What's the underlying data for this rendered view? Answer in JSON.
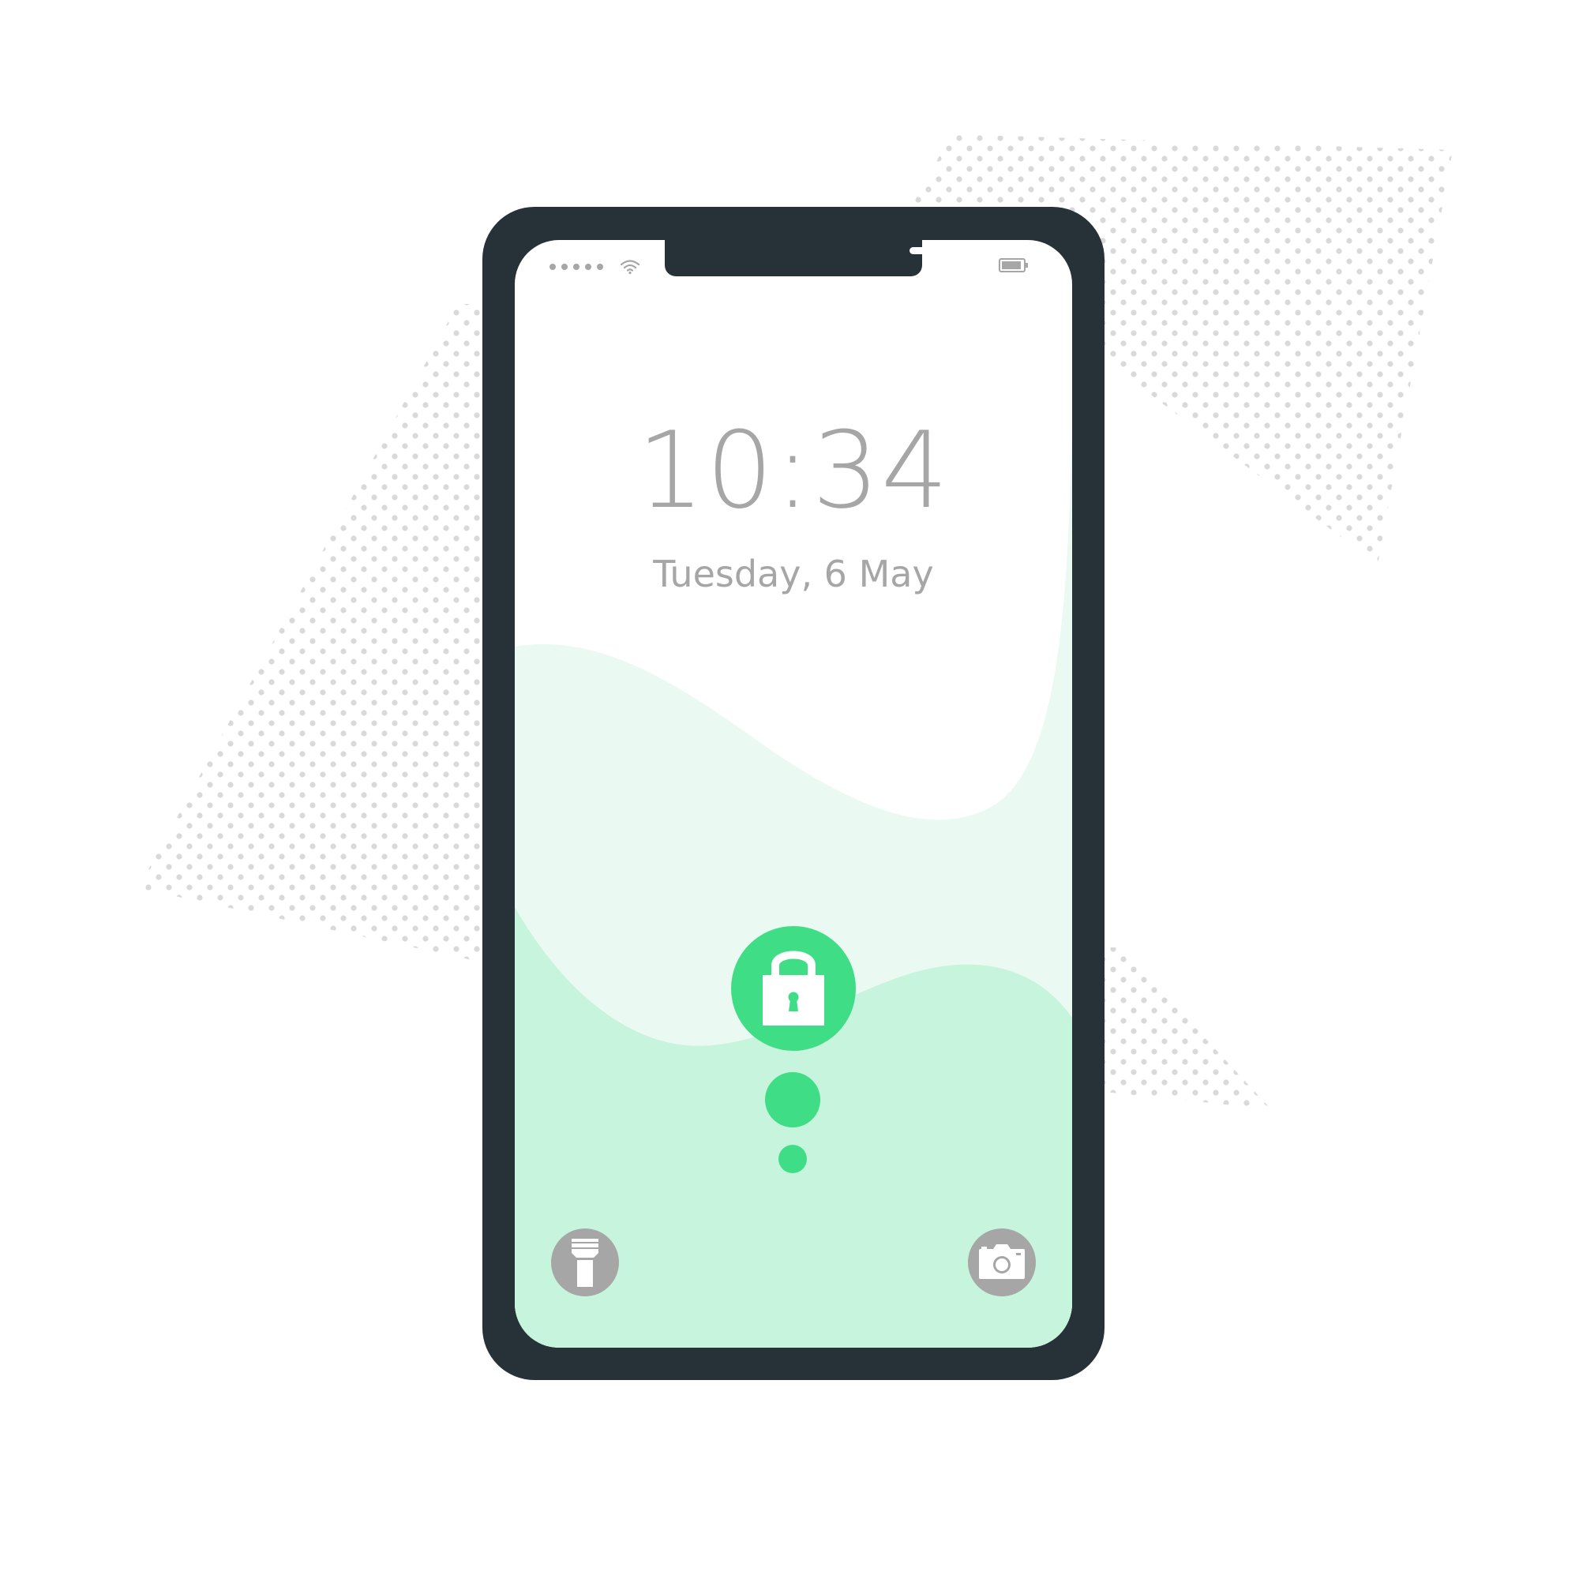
{
  "lock_screen": {
    "time": "10:34",
    "date": "Tuesday, 6 May"
  },
  "status_bar": {
    "signal_icon": "cellular-signal-dots-icon",
    "wifi_icon": "wifi-icon",
    "battery_icon": "battery-icon"
  },
  "controls": {
    "unlock_icon": "padlock-icon",
    "flashlight_icon": "flashlight-icon",
    "camera_icon": "camera-icon"
  },
  "colors": {
    "phone_body": "#263238",
    "accent_green": "#40dd87",
    "wave_light": "#eaf9f1",
    "wave_mid": "#c7f4dc",
    "text_gray": "#a6a6a6",
    "dot_pattern": "#d9d9d9"
  }
}
